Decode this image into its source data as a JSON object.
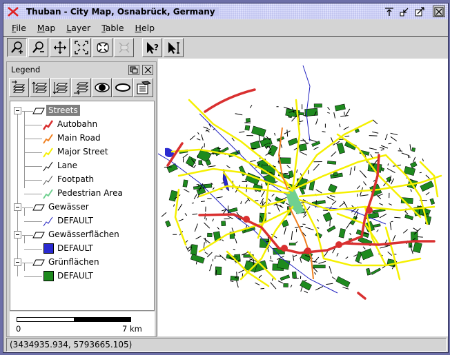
{
  "window": {
    "title": "Thuban - City Map, Osnabrück, Germany",
    "app_icon": "thuban-x-icon",
    "title_buttons": [
      "raise-icon",
      "iconify-icon",
      "maximize-icon",
      "close-icon"
    ]
  },
  "menubar": {
    "items": [
      {
        "label": "File",
        "mnemonic": "F"
      },
      {
        "label": "Map",
        "mnemonic": "M"
      },
      {
        "label": "Layer",
        "mnemonic": "L"
      },
      {
        "label": "Table",
        "mnemonic": "T"
      },
      {
        "label": "Help",
        "mnemonic": "H"
      }
    ]
  },
  "toolbar": {
    "tools": [
      {
        "name": "zoom-in",
        "icon": "zoom-in-icon",
        "pressed": true,
        "enabled": true
      },
      {
        "name": "zoom-out",
        "icon": "zoom-out-icon",
        "pressed": false,
        "enabled": true
      },
      {
        "name": "pan",
        "icon": "pan-icon",
        "pressed": false,
        "enabled": true
      },
      {
        "name": "full-extent",
        "icon": "full-extent-icon",
        "pressed": false,
        "enabled": true
      },
      {
        "name": "full-layer-extent",
        "icon": "full-layer-extent-icon",
        "pressed": false,
        "enabled": true
      },
      {
        "name": "full-selection-extent",
        "icon": "full-selection-extent-icon",
        "pressed": false,
        "enabled": false
      },
      {
        "name": "identify",
        "icon": "identify-icon",
        "pressed": false,
        "enabled": true
      },
      {
        "name": "label",
        "icon": "label-icon",
        "pressed": false,
        "enabled": true
      }
    ]
  },
  "legend": {
    "title": "Legend",
    "tools": [
      {
        "name": "move-to-top",
        "icon": "layer-top-icon"
      },
      {
        "name": "move-up",
        "icon": "layer-up-icon"
      },
      {
        "name": "move-down",
        "icon": "layer-down-icon"
      },
      {
        "name": "move-to-bottom",
        "icon": "layer-bottom-icon"
      },
      {
        "name": "show-layer",
        "icon": "eye-open-icon"
      },
      {
        "name": "hide-layer",
        "icon": "eye-closed-icon"
      },
      {
        "name": "layer-properties",
        "icon": "properties-icon"
      }
    ],
    "layers": [
      {
        "name": "Streets",
        "selected": true,
        "classes": [
          {
            "label": "Autobahn",
            "type": "line",
            "color": "#d93030"
          },
          {
            "label": "Main Road",
            "type": "line",
            "color": "#f08020"
          },
          {
            "label": "Major Street",
            "type": "line",
            "color": "#f5f000"
          },
          {
            "label": "Lane",
            "type": "line",
            "color": "#000000"
          },
          {
            "label": "Footpath",
            "type": "line",
            "color": "#555555"
          },
          {
            "label": "Pedestrian Area",
            "type": "line",
            "color": "#70d090"
          }
        ]
      },
      {
        "name": "Gewässer",
        "selected": false,
        "classes": [
          {
            "label": "DEFAULT",
            "type": "line",
            "color": "#2020c0"
          }
        ]
      },
      {
        "name": "Gewässerflächen",
        "selected": false,
        "classes": [
          {
            "label": "DEFAULT",
            "type": "polygon",
            "color": "#2a2ad0"
          }
        ]
      },
      {
        "name": "Grünflächen",
        "selected": false,
        "classes": [
          {
            "label": "DEFAULT",
            "type": "polygon",
            "color": "#1e8a1e"
          }
        ]
      }
    ],
    "scalebar": {
      "start_label": "0",
      "end_label": "7 km"
    }
  },
  "statusbar": {
    "coordinates": "(3434935.934, 5793665.105)"
  },
  "colors": {
    "autobahn": "#d93030",
    "main_road": "#f08020",
    "major_street": "#f5f000",
    "green": "#1e8a1e",
    "water": "#2020c0",
    "pedestrian": "#70d090"
  }
}
